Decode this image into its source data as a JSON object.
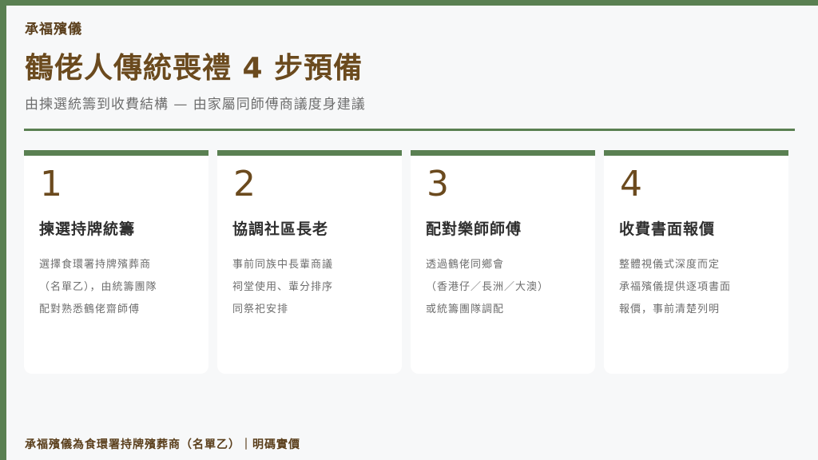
{
  "brand": "承福殯儀",
  "title": "鶴佬人傳統喪禮 4 步預備",
  "subtitle": "由揀選統籌到收費結構 — 由家屬同師傅商議度身建議",
  "cards": [
    {
      "number": "1",
      "title": "揀選持牌統籌",
      "lines": [
        "選擇食環署持牌殯葬商",
        "（名單乙），由統籌團隊",
        "配對熟悉鶴佬齋師傅"
      ]
    },
    {
      "number": "2",
      "title": "協調社區長老",
      "lines": [
        "事前同族中長輩商議",
        "祠堂使用、輩分排序",
        "同祭祀安排"
      ]
    },
    {
      "number": "3",
      "title": "配對樂師師傅",
      "lines": [
        "透過鶴佬同鄉會",
        "（香港仔／長洲／大澳）",
        "或統籌團隊調配"
      ]
    },
    {
      "number": "4",
      "title": "收費書面報價",
      "lines": [
        "整體視儀式深度而定",
        "承福殯儀提供逐項書面",
        "報價，事前清楚列明"
      ]
    }
  ],
  "footer": "承福殯儀為食環署持牌殯葬商（名單乙）｜明碼實價",
  "colors": {
    "accent_green": "#5a8052",
    "brown": "#6b4a1e",
    "background": "#f7f8f9"
  }
}
